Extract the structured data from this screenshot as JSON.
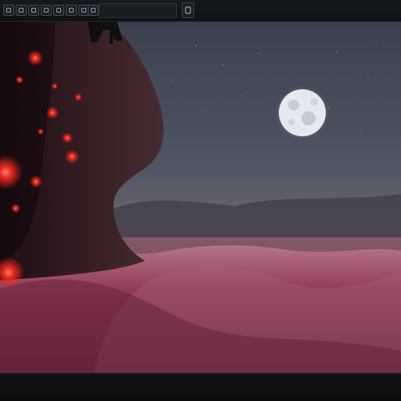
{
  "toolbar": {
    "buttons": [
      {
        "name": "tool-1-icon"
      },
      {
        "name": "tool-2-icon"
      },
      {
        "name": "tool-3-icon"
      },
      {
        "name": "tool-4-icon"
      },
      {
        "name": "tool-5-icon"
      },
      {
        "name": "tool-6-icon"
      },
      {
        "name": "tool-7-icon"
      },
      {
        "name": "tool-8-icon"
      }
    ],
    "search": {
      "value": "",
      "placeholder": ""
    },
    "right_button_icon": "page-icon"
  },
  "scene": {
    "description_colors": {
      "sky": "#4a5060",
      "moon": "#f2f5fb",
      "ground": "#8a3d58",
      "glow": "#ff2a1f"
    }
  }
}
